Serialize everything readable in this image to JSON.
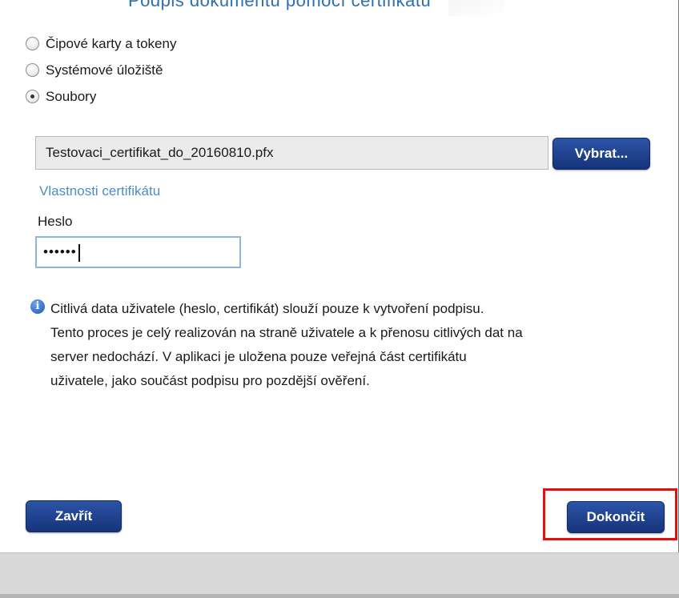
{
  "dialog": {
    "title": "Podpis dokumentu pomocí certifikátu"
  },
  "source_options": [
    {
      "label": "Čipové karty a tokeny",
      "checked": false
    },
    {
      "label": "Systémové úložiště",
      "checked": false
    },
    {
      "label": "Soubory",
      "checked": true
    }
  ],
  "file": {
    "value": "Testovaci_certifikat_do_20160810.pfx",
    "choose_label": "Vybrat..."
  },
  "certificate_properties_link": "Vlastnosti certifikátu",
  "password": {
    "label": "Heslo",
    "masked_value": "••••••"
  },
  "info": {
    "icon": "info-icon",
    "lines": [
      "Citlivá data uživatele (heslo, certifikát) slouží pouze k vytvoření podpisu.",
      "Tento proces je celý realizován na straně uživatele a k přenosu citlivých dat na",
      "server nedochází. V aplikaci je uložena pouze veřejná část certifikátu",
      "uživatele, jako součást podpisu pro pozdější ověření."
    ]
  },
  "buttons": {
    "close_label": "Zavřít",
    "finish_label": "Dokončit"
  },
  "colors": {
    "button_blue": "#1f3f8f",
    "link_blue": "#4d8bc9",
    "highlight_red": "#e01010",
    "footer_gray": "#d8d8d8"
  }
}
